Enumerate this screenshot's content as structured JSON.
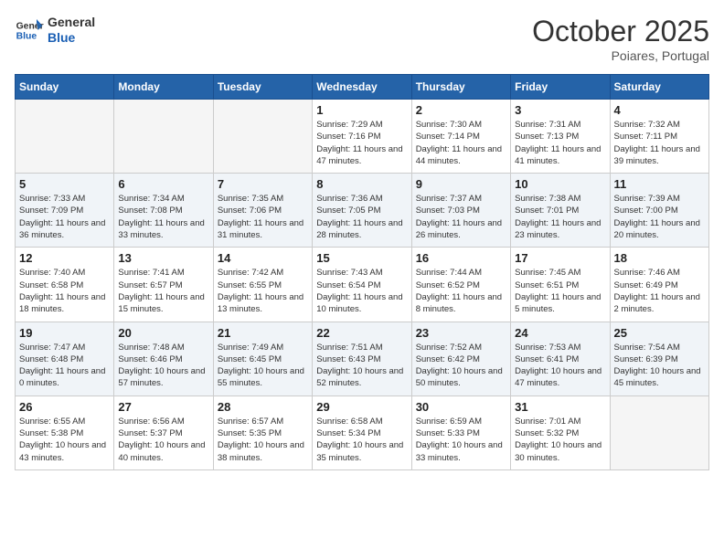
{
  "header": {
    "logo_line1": "General",
    "logo_line2": "Blue",
    "month": "October 2025",
    "location": "Poiares, Portugal"
  },
  "days_of_week": [
    "Sunday",
    "Monday",
    "Tuesday",
    "Wednesday",
    "Thursday",
    "Friday",
    "Saturday"
  ],
  "weeks": [
    [
      {
        "day": "",
        "info": ""
      },
      {
        "day": "",
        "info": ""
      },
      {
        "day": "",
        "info": ""
      },
      {
        "day": "1",
        "info": "Sunrise: 7:29 AM\nSunset: 7:16 PM\nDaylight: 11 hours and 47 minutes."
      },
      {
        "day": "2",
        "info": "Sunrise: 7:30 AM\nSunset: 7:14 PM\nDaylight: 11 hours and 44 minutes."
      },
      {
        "day": "3",
        "info": "Sunrise: 7:31 AM\nSunset: 7:13 PM\nDaylight: 11 hours and 41 minutes."
      },
      {
        "day": "4",
        "info": "Sunrise: 7:32 AM\nSunset: 7:11 PM\nDaylight: 11 hours and 39 minutes."
      }
    ],
    [
      {
        "day": "5",
        "info": "Sunrise: 7:33 AM\nSunset: 7:09 PM\nDaylight: 11 hours and 36 minutes."
      },
      {
        "day": "6",
        "info": "Sunrise: 7:34 AM\nSunset: 7:08 PM\nDaylight: 11 hours and 33 minutes."
      },
      {
        "day": "7",
        "info": "Sunrise: 7:35 AM\nSunset: 7:06 PM\nDaylight: 11 hours and 31 minutes."
      },
      {
        "day": "8",
        "info": "Sunrise: 7:36 AM\nSunset: 7:05 PM\nDaylight: 11 hours and 28 minutes."
      },
      {
        "day": "9",
        "info": "Sunrise: 7:37 AM\nSunset: 7:03 PM\nDaylight: 11 hours and 26 minutes."
      },
      {
        "day": "10",
        "info": "Sunrise: 7:38 AM\nSunset: 7:01 PM\nDaylight: 11 hours and 23 minutes."
      },
      {
        "day": "11",
        "info": "Sunrise: 7:39 AM\nSunset: 7:00 PM\nDaylight: 11 hours and 20 minutes."
      }
    ],
    [
      {
        "day": "12",
        "info": "Sunrise: 7:40 AM\nSunset: 6:58 PM\nDaylight: 11 hours and 18 minutes."
      },
      {
        "day": "13",
        "info": "Sunrise: 7:41 AM\nSunset: 6:57 PM\nDaylight: 11 hours and 15 minutes."
      },
      {
        "day": "14",
        "info": "Sunrise: 7:42 AM\nSunset: 6:55 PM\nDaylight: 11 hours and 13 minutes."
      },
      {
        "day": "15",
        "info": "Sunrise: 7:43 AM\nSunset: 6:54 PM\nDaylight: 11 hours and 10 minutes."
      },
      {
        "day": "16",
        "info": "Sunrise: 7:44 AM\nSunset: 6:52 PM\nDaylight: 11 hours and 8 minutes."
      },
      {
        "day": "17",
        "info": "Sunrise: 7:45 AM\nSunset: 6:51 PM\nDaylight: 11 hours and 5 minutes."
      },
      {
        "day": "18",
        "info": "Sunrise: 7:46 AM\nSunset: 6:49 PM\nDaylight: 11 hours and 2 minutes."
      }
    ],
    [
      {
        "day": "19",
        "info": "Sunrise: 7:47 AM\nSunset: 6:48 PM\nDaylight: 11 hours and 0 minutes."
      },
      {
        "day": "20",
        "info": "Sunrise: 7:48 AM\nSunset: 6:46 PM\nDaylight: 10 hours and 57 minutes."
      },
      {
        "day": "21",
        "info": "Sunrise: 7:49 AM\nSunset: 6:45 PM\nDaylight: 10 hours and 55 minutes."
      },
      {
        "day": "22",
        "info": "Sunrise: 7:51 AM\nSunset: 6:43 PM\nDaylight: 10 hours and 52 minutes."
      },
      {
        "day": "23",
        "info": "Sunrise: 7:52 AM\nSunset: 6:42 PM\nDaylight: 10 hours and 50 minutes."
      },
      {
        "day": "24",
        "info": "Sunrise: 7:53 AM\nSunset: 6:41 PM\nDaylight: 10 hours and 47 minutes."
      },
      {
        "day": "25",
        "info": "Sunrise: 7:54 AM\nSunset: 6:39 PM\nDaylight: 10 hours and 45 minutes."
      }
    ],
    [
      {
        "day": "26",
        "info": "Sunrise: 6:55 AM\nSunset: 5:38 PM\nDaylight: 10 hours and 43 minutes."
      },
      {
        "day": "27",
        "info": "Sunrise: 6:56 AM\nSunset: 5:37 PM\nDaylight: 10 hours and 40 minutes."
      },
      {
        "day": "28",
        "info": "Sunrise: 6:57 AM\nSunset: 5:35 PM\nDaylight: 10 hours and 38 minutes."
      },
      {
        "day": "29",
        "info": "Sunrise: 6:58 AM\nSunset: 5:34 PM\nDaylight: 10 hours and 35 minutes."
      },
      {
        "day": "30",
        "info": "Sunrise: 6:59 AM\nSunset: 5:33 PM\nDaylight: 10 hours and 33 minutes."
      },
      {
        "day": "31",
        "info": "Sunrise: 7:01 AM\nSunset: 5:32 PM\nDaylight: 10 hours and 30 minutes."
      },
      {
        "day": "",
        "info": ""
      }
    ]
  ]
}
